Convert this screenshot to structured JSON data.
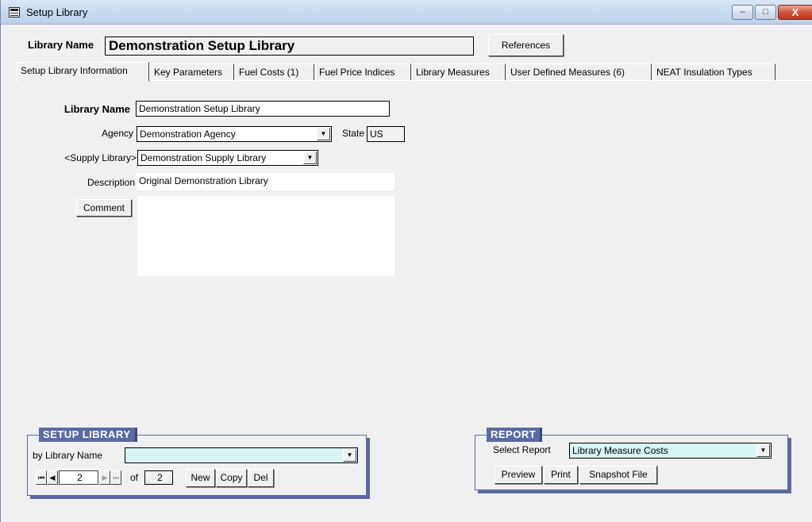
{
  "window": {
    "title": "Setup Library",
    "controls": {
      "minimize": "–",
      "maximize": "□",
      "close": "X"
    }
  },
  "header": {
    "library_name_label": "Library Name",
    "library_name_value": "Demonstration Setup Library",
    "references_button": "References"
  },
  "tabs": [
    {
      "label": "Setup Library Information",
      "active": true
    },
    {
      "label": "Key Parameters"
    },
    {
      "label": "Fuel Costs (1)"
    },
    {
      "label": "Fuel Price Indices"
    },
    {
      "label": "Library Measures"
    },
    {
      "label": "User Defined Measures (6)"
    },
    {
      "label": "NEAT Insulation Types"
    }
  ],
  "form": {
    "library_name": {
      "label": "Library Name",
      "value": "Demonstration Setup Library"
    },
    "agency": {
      "label": "Agency",
      "value": "Demonstration Agency"
    },
    "state": {
      "label": "State",
      "value": "US"
    },
    "supply_library": {
      "label": "<Supply Library>",
      "value": "Demonstration Supply Library"
    },
    "description": {
      "label": "Description",
      "value": "Original Demonstration Library"
    },
    "comment_button": "Comment",
    "comment_value": ""
  },
  "setup_library_group": {
    "title": "SETUP LIBRARY",
    "by_label": "by Library  Name",
    "search_value": "",
    "nav": {
      "first": "⏮",
      "prev": "◀",
      "next": "▶",
      "last": "⏭",
      "current": "2",
      "of_label": "of",
      "total": "2"
    },
    "buttons": {
      "new": "New",
      "copy": "Copy",
      "del": "Del"
    }
  },
  "report_group": {
    "title": "REPORT",
    "select_label": "Select Report",
    "selected_report": "Library Measure Costs",
    "buttons": {
      "preview": "Preview",
      "print": "Print",
      "snapshot": "Snapshot File"
    }
  },
  "icons": {
    "combo_arrow": "▼"
  }
}
